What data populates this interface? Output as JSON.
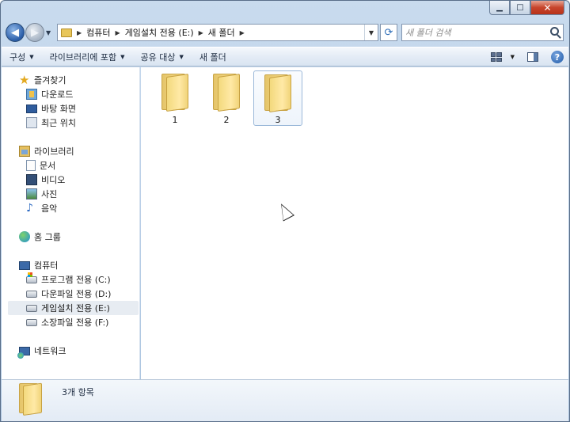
{
  "window": {
    "caption_buttons": {
      "minimize": "▁",
      "maximize": "□",
      "close": "✕"
    }
  },
  "nav": {
    "back_icon": "back-arrow-icon",
    "back_glyph": "◀",
    "forward_glyph": "▶",
    "address": {
      "separator_glyph": "▶",
      "dropdown_glyph": "▼",
      "breadcrumbs": [
        "컴퓨터",
        "게임설치 전용 (E:)",
        "새 폴더"
      ]
    },
    "refresh_glyph": "⟳",
    "search_placeholder": "새 폴더 검색"
  },
  "toolbar": {
    "buttons": [
      {
        "label": "구성",
        "has_dropdown": true
      },
      {
        "label": "라이브러리에 포함",
        "has_dropdown": true
      },
      {
        "label": "공유 대상",
        "has_dropdown": true
      },
      {
        "label": "새 폴더",
        "has_dropdown": false
      }
    ],
    "dropdown_glyph": "▼",
    "help_glyph": "?"
  },
  "navpane": {
    "favorites": {
      "label": "즐겨찾기",
      "items": [
        "다운로드",
        "바탕 화면",
        "최근 위치"
      ]
    },
    "libraries": {
      "label": "라이브러리",
      "items": [
        "문서",
        "비디오",
        "사진",
        "음악"
      ]
    },
    "homegroup": {
      "label": "홈 그룹"
    },
    "computer": {
      "label": "컴퓨터",
      "items": [
        "프로그램 전용 (C:)",
        "다운파일 전용 (D:)",
        "게임설치 전용 (E:)",
        "소장파일 전용 (F:)"
      ],
      "selected_index": 2
    },
    "network": {
      "label": "네트워크"
    }
  },
  "content": {
    "folders": [
      "1",
      "2",
      "3"
    ],
    "selected_index": 2
  },
  "details": {
    "item_count": "3개 항목"
  },
  "colors": {
    "window_frame": "#b7cde6",
    "toolbar_bg": "#e4ecf6",
    "selection": "#eef4fb",
    "folder": "#f3d97d"
  }
}
